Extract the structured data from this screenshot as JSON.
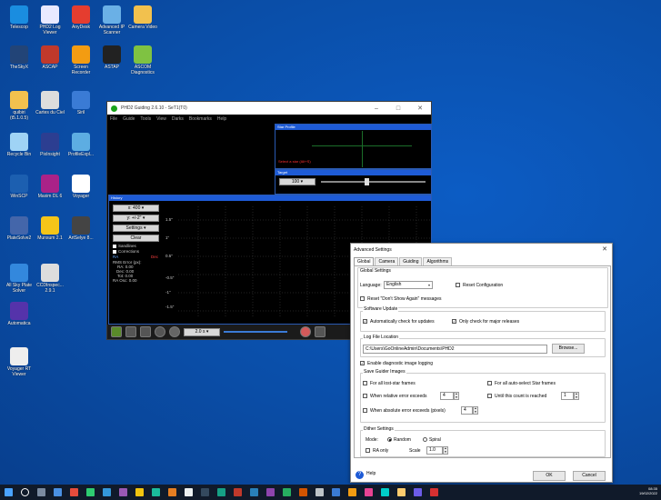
{
  "desktop": {
    "icons": [
      {
        "label": "Telescop",
        "color": "#1a8de0",
        "icon": "telescope-app-icon"
      },
      {
        "label": "PHD2 Log Viewer",
        "color": "#e9e9ff",
        "icon": "log-viewer-icon"
      },
      {
        "label": "AnyDesk",
        "color": "#e53d2f",
        "icon": "anydesk-icon"
      },
      {
        "label": "Advanced IP Scanner",
        "color": "#6ab0e6",
        "icon": "ip-scanner-icon"
      },
      {
        "label": "Camera Video",
        "color": "#f2c14e",
        "icon": "folder-icon"
      },
      {
        "label": "TheSkyX",
        "color": "#224477",
        "icon": "theskyx-icon"
      },
      {
        "label": "ASCAP",
        "color": "#c0392b",
        "icon": "ascap-icon"
      },
      {
        "label": "Screen Recorder",
        "color": "#f39c12",
        "icon": "screen-recorder-icon"
      },
      {
        "label": "ASTAP",
        "color": "#222222",
        "icon": "astap-icon"
      },
      {
        "label": "ASCOM Diagnostics",
        "color": "#7fc242",
        "icon": "ascom-icon"
      },
      {
        "label": "quibiri (t5.1.0.5)",
        "color": "#f2c14e",
        "icon": "folder-icon"
      },
      {
        "label": "Cartes du Ciel",
        "color": "#dddddd",
        "icon": "cartes-du-ciel-icon"
      },
      {
        "label": "Siril",
        "color": "#3a7bd5",
        "icon": "siril-icon"
      },
      {
        "label": "Recycle Bin",
        "color": "#9fd3f5",
        "icon": "recycle-bin-icon"
      },
      {
        "label": "PixInsight",
        "color": "#2c3e91",
        "icon": "pixinsight-icon"
      },
      {
        "label": "ProfileExpl...",
        "color": "#5dade2",
        "icon": "profile-explorer-icon"
      },
      {
        "label": "WinSCP",
        "color": "#1c5fb0",
        "icon": "winscp-icon"
      },
      {
        "label": "Maxim DL 6",
        "color": "#aa2288",
        "icon": "maxim-dl-icon"
      },
      {
        "label": "Voyager",
        "color": "#ffffff",
        "icon": "voyager-icon"
      },
      {
        "label": "PlateSolve2",
        "color": "#4466aa",
        "icon": "platesolve-icon"
      },
      {
        "label": "Munsum 2.1",
        "color": "#f5c518",
        "icon": "star-icon"
      },
      {
        "label": "ArtSelye 8...",
        "color": "#444444",
        "icon": "artselye-icon"
      },
      {
        "label": "All Sky Plate Solver",
        "color": "#3388dd",
        "icon": "all-sky-icon"
      },
      {
        "label": "CCDInspec... 2.9.1",
        "color": "#dddddd",
        "icon": "ccd-inspector-icon"
      },
      {
        "label": "Automatica",
        "color": "#5533aa",
        "icon": "automatica-icon"
      },
      {
        "label": "Voyager RT Viewer",
        "color": "#eeeeee",
        "icon": "voyager-rt-icon"
      }
    ]
  },
  "phd": {
    "title": "PHD2 Guiding 2.6.10 - SeT1(T0)",
    "menu": [
      "File",
      "Guide",
      "Tools",
      "View",
      "Darks",
      "Bookmarks",
      "Help"
    ],
    "star_profile_title": "Star Profile",
    "star_profile_msg": "Select a star (Alt+S)",
    "target_title": "Target",
    "target_scale": "100",
    "history_title": "History",
    "x_scale": "x: 400",
    "y_scale": "y: +/-2\"",
    "settings_label": "Settings",
    "clear_label": "Clear",
    "sandlines": "Sandlines",
    "corrections": "Corrections",
    "ra_label": "RA",
    "dec_label": "Dec",
    "rms_title": "RMS Error (px):",
    "rms_ra": "RA: 0.00",
    "rms_dec": "Dec: 0.00",
    "rms_tot": "Tot: 0.00",
    "ra_osc": "RA Osc: 0.00",
    "y_ticks": [
      "1.5\"",
      "1\"",
      "0.5\"",
      "-0.5\"",
      "-1\"",
      "-1.5\""
    ],
    "exposure": "2.0 s"
  },
  "adv": {
    "title": "Advanced Settings",
    "tabs": [
      "Global",
      "Camera",
      "Guiding",
      "Algorithms"
    ],
    "global_settings": "Global Settings",
    "language_label": "Language:",
    "language_value": "English",
    "reset_config": "Reset Configuration",
    "reset_dont_show": "Reset \"Don't Show Again\" messages",
    "software_update": "Software Update",
    "auto_check": "Automatically check for updates",
    "major_only": "Only check for major releases",
    "log_file_location": "Log File Location",
    "log_path": "C:\\Users\\GoOnlineAdmin\\Documents\\PHD2",
    "browse": "Browse...",
    "enable_diag": "Enable diagnostic image logging",
    "save_guider_images": "Save Guider Images",
    "for_lost": "For all lost-star frames",
    "for_auto": "For all auto-select Star frames",
    "when_relative": "When relative error exceeds",
    "relative_value": "4",
    "until_count": "Until this count is reached",
    "until_value": "1",
    "when_absolute": "When absolute error exceeds (pixels)",
    "absolute_value": "4",
    "dither_settings": "Dither Settings",
    "mode_label": "Mode:",
    "random": "Random",
    "spiral": "Spiral",
    "ra_only": "RA only",
    "scale_label": "Scale",
    "scale_value": "1.0",
    "help": "Help",
    "ok": "OK",
    "cancel": "Cancel"
  },
  "taskbar": {
    "time": "08:35",
    "date": "19/02/2022"
  }
}
